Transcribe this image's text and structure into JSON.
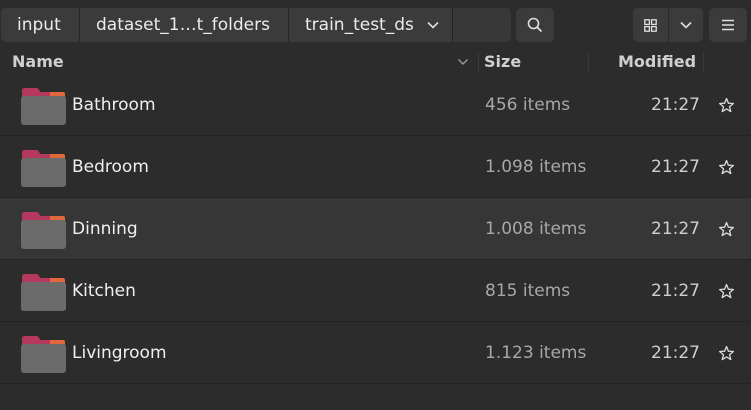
{
  "pathbar": {
    "crumbs": [
      "input",
      "dataset_1…t_folders",
      "train_test_ds"
    ]
  },
  "toolbar": {
    "search_icon": "search-icon",
    "view_icon": "grid-icon",
    "view_options_icon": "chevron-down-icon",
    "menu_icon": "hamburger-icon"
  },
  "columns": {
    "name": "Name",
    "size": "Size",
    "modified": "Modified"
  },
  "rows": [
    {
      "name": "Bathroom",
      "size": "456 items",
      "modified": "21:27",
      "icon": "folder-icon"
    },
    {
      "name": "Bedroom",
      "size": "1.098 items",
      "modified": "21:27",
      "icon": "folder-icon"
    },
    {
      "name": "Dinning",
      "size": "1.008 items",
      "modified": "21:27",
      "icon": "folder-icon"
    },
    {
      "name": "Kitchen",
      "size": "815 items",
      "modified": "21:27",
      "icon": "folder-icon"
    },
    {
      "name": "Livingroom",
      "size": "1.123 items",
      "modified": "21:27",
      "icon": "folder-icon"
    }
  ],
  "colors": {
    "background": "#2c2c2c",
    "hover_row": "#363636",
    "folder_body": "#6b6b6b",
    "folder_tab_pink": "#b5395f",
    "folder_tab_orange": "#e2673a"
  }
}
